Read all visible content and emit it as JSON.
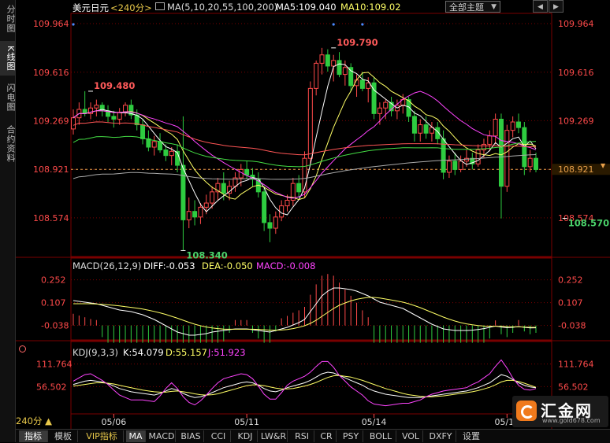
{
  "sidebar": {
    "tabs": [
      {
        "label": "分时图",
        "active": false
      },
      {
        "label": "K线图",
        "active": true
      },
      {
        "label": "闪电图",
        "active": false
      },
      {
        "label": "合约资料",
        "active": false
      }
    ]
  },
  "header": {
    "symbol": "美元日元",
    "period": "<240分>",
    "ma_label": "MA(5,10,20,55,100,200)",
    "ma5": "MA5:109.040",
    "ma10": "MA10:109.02",
    "theme_select": "全部主题",
    "nav_buttons": [
      "◀",
      "▶"
    ]
  },
  "macd_header": {
    "name": "MACD(26,12,9)",
    "diff": "DIFF:-0.053",
    "dea": "DEA:-0.050",
    "macd": "MACD:-0.008"
  },
  "kdj_header": {
    "name": "KDJ(9,3,3)",
    "k": "K:54.079",
    "d": "D:55.157",
    "j": "J:51.923"
  },
  "period_select": "240分 ▲",
  "bottom_tabs": [
    {
      "label": "指标",
      "active": true
    },
    {
      "label": "模板"
    },
    {
      "label": "VIP指标",
      "vip": true
    },
    {
      "label": "MA",
      "active": true
    },
    {
      "label": "MACD"
    },
    {
      "label": "BIAS"
    },
    {
      "label": "CCI"
    },
    {
      "label": "KDJ"
    },
    {
      "label": "LW&R"
    },
    {
      "label": "RSI"
    },
    {
      "label": "CR"
    },
    {
      "label": "PSY"
    },
    {
      "label": "BOLL"
    },
    {
      "label": "VOL"
    },
    {
      "label": "DXFY"
    },
    {
      "label": "设置"
    }
  ],
  "logo": {
    "name": "汇金网",
    "url": "www.gold678.com"
  },
  "colors": {
    "up": "#ff4a4a",
    "down": "#2ecc40",
    "axis": "#ff4a4a",
    "grid": "#7a0000",
    "ma5": "#ffffff",
    "ma10": "#ffff66",
    "ma20": "#ff44ff",
    "ma55": "#44dd44",
    "ma100": "#ff5555",
    "ma200": "#aaaaaa",
    "dif": "#ffffff",
    "dea": "#ffff66",
    "kdj_k": "#ffffff",
    "kdj_d": "#ffff66",
    "kdj_j": "#ff44ff"
  },
  "chart_data": [
    {
      "type": "candlestick",
      "title": "美元日元 <240分>",
      "y_ticks": [
        109.964,
        109.616,
        109.269,
        108.921,
        108.574
      ],
      "ylim": [
        108.32,
        110.02
      ],
      "x_ticks": [
        {
          "label": "05/06",
          "index": 7
        },
        {
          "label": "05/11",
          "index": 30
        },
        {
          "label": "05/14",
          "index": 52
        },
        {
          "label": "05/19",
          "index": 75
        }
      ],
      "last_price": 108.921,
      "annotations": [
        {
          "text": "109.480",
          "index": 3,
          "value": 109.48
        },
        {
          "text": "109.790",
          "index": 45,
          "value": 109.79
        },
        {
          "text": "108.340",
          "index": 19,
          "value": 108.34
        },
        {
          "text": "108.570",
          "index": 85,
          "value": 108.57
        }
      ],
      "ohlc": [
        [
          109.21,
          109.35,
          109.17,
          109.29
        ],
        [
          109.29,
          109.4,
          109.24,
          109.35
        ],
        [
          109.35,
          109.48,
          109.3,
          109.32
        ],
        [
          109.32,
          109.4,
          109.28,
          109.36
        ],
        [
          109.36,
          109.42,
          109.3,
          109.38
        ],
        [
          109.38,
          109.4,
          109.3,
          109.34
        ],
        [
          109.34,
          109.38,
          109.26,
          109.3
        ],
        [
          109.3,
          109.34,
          109.22,
          109.28
        ],
        [
          109.28,
          109.36,
          109.24,
          109.33
        ],
        [
          109.33,
          109.4,
          109.3,
          109.38
        ],
        [
          109.38,
          109.42,
          109.28,
          109.31
        ],
        [
          109.31,
          109.35,
          109.2,
          109.24
        ],
        [
          109.24,
          109.28,
          109.1,
          109.14
        ],
        [
          109.14,
          109.2,
          109.05,
          109.08
        ],
        [
          109.08,
          109.16,
          109.02,
          109.12
        ],
        [
          109.12,
          109.18,
          109.04,
          109.06
        ],
        [
          109.06,
          109.1,
          108.98,
          109.02
        ],
        [
          109.02,
          109.08,
          108.95,
          109.05
        ],
        [
          109.05,
          109.1,
          108.9,
          108.95
        ],
        [
          108.95,
          109.3,
          108.34,
          108.56
        ],
        [
          108.56,
          108.72,
          108.5,
          108.62
        ],
        [
          108.62,
          108.7,
          108.52,
          108.58
        ],
        [
          108.58,
          108.68,
          108.53,
          108.65
        ],
        [
          108.65,
          108.74,
          108.6,
          108.68
        ],
        [
          108.68,
          108.8,
          108.64,
          108.76
        ],
        [
          108.76,
          108.86,
          108.7,
          108.82
        ],
        [
          108.82,
          108.9,
          108.7,
          108.75
        ],
        [
          108.75,
          108.84,
          108.7,
          108.8
        ],
        [
          108.8,
          108.9,
          108.76,
          108.86
        ],
        [
          108.86,
          108.96,
          108.8,
          108.92
        ],
        [
          108.92,
          108.98,
          108.85,
          108.88
        ],
        [
          108.88,
          108.93,
          108.8,
          108.85
        ],
        [
          108.85,
          108.9,
          108.72,
          108.76
        ],
        [
          108.76,
          108.8,
          108.48,
          108.54
        ],
        [
          108.54,
          108.6,
          108.4,
          108.5
        ],
        [
          108.5,
          108.62,
          108.46,
          108.58
        ],
        [
          108.58,
          108.7,
          108.55,
          108.66
        ],
        [
          108.66,
          108.74,
          108.62,
          108.7
        ],
        [
          108.7,
          108.86,
          108.66,
          108.82
        ],
        [
          108.82,
          108.88,
          108.72,
          108.76
        ],
        [
          108.76,
          109.05,
          108.72,
          109.0
        ],
        [
          109.0,
          109.55,
          108.95,
          109.5
        ],
        [
          109.5,
          109.7,
          109.45,
          109.68
        ],
        [
          109.68,
          109.79,
          109.6,
          109.74
        ],
        [
          109.74,
          109.78,
          109.62,
          109.66
        ],
        [
          109.66,
          109.74,
          109.55,
          109.7
        ],
        [
          109.7,
          109.76,
          109.58,
          109.6
        ],
        [
          109.6,
          109.7,
          109.52,
          109.65
        ],
        [
          109.65,
          109.68,
          109.48,
          109.52
        ],
        [
          109.52,
          109.6,
          109.44,
          109.56
        ],
        [
          109.56,
          109.62,
          109.48,
          109.5
        ],
        [
          109.5,
          109.58,
          109.4,
          109.54
        ],
        [
          109.54,
          109.58,
          109.28,
          109.32
        ],
        [
          109.32,
          109.4,
          109.24,
          109.36
        ],
        [
          109.36,
          109.42,
          109.28,
          109.4
        ],
        [
          109.4,
          109.44,
          109.3,
          109.34
        ],
        [
          109.34,
          109.42,
          109.28,
          109.38
        ],
        [
          109.38,
          109.46,
          109.32,
          109.42
        ],
        [
          109.42,
          109.44,
          109.26,
          109.3
        ],
        [
          109.3,
          109.34,
          109.12,
          109.18
        ],
        [
          109.18,
          109.28,
          109.12,
          109.24
        ],
        [
          109.24,
          109.3,
          109.14,
          109.18
        ],
        [
          109.18,
          109.26,
          109.12,
          109.22
        ],
        [
          109.22,
          109.26,
          109.1,
          109.14
        ],
        [
          109.14,
          109.2,
          108.85,
          108.9
        ],
        [
          108.9,
          109.02,
          108.86,
          108.98
        ],
        [
          108.98,
          109.04,
          108.88,
          108.92
        ],
        [
          108.92,
          109.02,
          108.9,
          108.98
        ],
        [
          108.98,
          109.06,
          108.94,
          109.0
        ],
        [
          109.0,
          109.04,
          108.92,
          108.96
        ],
        [
          108.96,
          109.1,
          108.94,
          109.06
        ],
        [
          109.06,
          109.14,
          109.0,
          109.1
        ],
        [
          109.1,
          109.2,
          109.05,
          109.16
        ],
        [
          109.16,
          109.32,
          109.1,
          109.28
        ],
        [
          109.28,
          109.32,
          108.57,
          108.8
        ],
        [
          108.8,
          109.24,
          108.76,
          109.2
        ],
        [
          109.2,
          109.3,
          109.15,
          109.26
        ],
        [
          109.26,
          109.32,
          109.18,
          109.22
        ],
        [
          109.22,
          109.26,
          108.88,
          108.94
        ],
        [
          108.94,
          109.06,
          108.9,
          109.0
        ],
        [
          109.0,
          109.04,
          108.9,
          108.92
        ]
      ]
    },
    {
      "type": "line",
      "title": "MACD(26,12,9)",
      "y_ticks": [
        0.252,
        0.107,
        -0.038
      ],
      "ylim": [
        -0.12,
        0.32
      ],
      "series": [
        {
          "name": "DIFF",
          "values": [
            0.12,
            0.115,
            0.11,
            0.105,
            0.1,
            0.09,
            0.08,
            0.07,
            0.06,
            0.055,
            0.05,
            0.04,
            0.03,
            0.015,
            0.0,
            -0.02,
            -0.04,
            -0.06,
            -0.08,
            -0.09,
            -0.1,
            -0.1,
            -0.095,
            -0.09,
            -0.08,
            -0.075,
            -0.07,
            -0.065,
            -0.06,
            -0.06,
            -0.06,
            -0.065,
            -0.07,
            -0.075,
            -0.08,
            -0.07,
            -0.06,
            -0.05,
            -0.035,
            -0.02,
            0.0,
            0.05,
            0.1,
            0.15,
            0.18,
            0.2,
            0.2,
            0.195,
            0.19,
            0.18,
            0.165,
            0.15,
            0.13,
            0.11,
            0.1,
            0.09,
            0.08,
            0.07,
            0.05,
            0.03,
            0.01,
            -0.01,
            -0.03,
            -0.045,
            -0.06,
            -0.065,
            -0.07,
            -0.07,
            -0.07,
            -0.068,
            -0.064,
            -0.058,
            -0.05,
            -0.042,
            -0.048,
            -0.052,
            -0.05,
            -0.045,
            -0.05,
            -0.054,
            -0.053
          ]
        },
        {
          "name": "DEA",
          "values": [
            0.1,
            0.1,
            0.1,
            0.1,
            0.098,
            0.096,
            0.093,
            0.09,
            0.086,
            0.081,
            0.077,
            0.072,
            0.066,
            0.059,
            0.051,
            0.042,
            0.032,
            0.02,
            0.008,
            -0.005,
            -0.018,
            -0.03,
            -0.04,
            -0.048,
            -0.054,
            -0.058,
            -0.061,
            -0.062,
            -0.062,
            -0.062,
            -0.062,
            -0.062,
            -0.063,
            -0.065,
            -0.068,
            -0.068,
            -0.067,
            -0.064,
            -0.058,
            -0.05,
            -0.04,
            -0.025,
            -0.005,
            0.02,
            0.045,
            0.07,
            0.09,
            0.105,
            0.118,
            0.128,
            0.135,
            0.14,
            0.14,
            0.136,
            0.13,
            0.124,
            0.117,
            0.11,
            0.1,
            0.088,
            0.075,
            0.06,
            0.045,
            0.03,
            0.015,
            0.002,
            -0.01,
            -0.02,
            -0.028,
            -0.034,
            -0.039,
            -0.042,
            -0.043,
            -0.043,
            -0.044,
            -0.046,
            -0.047,
            -0.047,
            -0.048,
            -0.05,
            -0.05
          ]
        }
      ]
    },
    {
      "type": "line",
      "title": "KDJ(9,3,3)",
      "y_ticks": [
        111.764,
        56.502
      ],
      "ylim": [
        -10,
        140
      ],
      "series": [
        {
          "name": "K",
          "values": [
            62,
            66,
            70,
            72,
            70,
            68,
            64,
            58,
            52,
            48,
            44,
            42,
            40,
            38,
            36,
            40,
            46,
            52,
            48,
            40,
            34,
            30,
            32,
            36,
            42,
            48,
            54,
            58,
            62,
            66,
            68,
            66,
            60,
            52,
            46,
            44,
            48,
            54,
            58,
            62,
            66,
            72,
            80,
            88,
            92,
            90,
            84,
            78,
            72,
            66,
            60,
            52,
            46,
            42,
            38,
            36,
            34,
            32,
            30,
            30,
            30,
            32,
            34,
            36,
            38,
            40,
            42,
            44,
            46,
            50,
            54,
            60,
            66,
            76,
            86,
            82,
            74,
            66,
            60,
            56,
            54
          ]
        },
        {
          "name": "D",
          "values": [
            58,
            60,
            62,
            64,
            66,
            66,
            65,
            63,
            60,
            57,
            54,
            51,
            48,
            46,
            44,
            43,
            43,
            45,
            46,
            44,
            42,
            39,
            37,
            36,
            37,
            39,
            43,
            47,
            51,
            55,
            59,
            61,
            61,
            59,
            56,
            53,
            51,
            51,
            52,
            55,
            58,
            62,
            67,
            73,
            79,
            83,
            84,
            82,
            80,
            76,
            72,
            67,
            62,
            57,
            52,
            48,
            44,
            40,
            37,
            35,
            33,
            32,
            32,
            33,
            34,
            36,
            38,
            40,
            42,
            44,
            47,
            51,
            55,
            61,
            68,
            72,
            72,
            69,
            65,
            60,
            55
          ]
        },
        {
          "name": "J",
          "values": [
            70,
            78,
            86,
            88,
            80,
            72,
            62,
            48,
            36,
            30,
            24,
            24,
            24,
            22,
            20,
            34,
            52,
            66,
            52,
            32,
            18,
            12,
            22,
            36,
            52,
            66,
            76,
            80,
            84,
            88,
            86,
            76,
            58,
            38,
            26,
            26,
            42,
            60,
            70,
            76,
            82,
            92,
            106,
            118,
            118,
            104,
            84,
            70,
            56,
            46,
            36,
            22,
            14,
            12,
            10,
            12,
            14,
            16,
            16,
            20,
            24,
            32,
            38,
            42,
            46,
            48,
            50,
            52,
            54,
            62,
            68,
            78,
            88,
            106,
            122,
            102,
            78,
            60,
            50,
            48,
            52
          ]
        }
      ]
    }
  ]
}
